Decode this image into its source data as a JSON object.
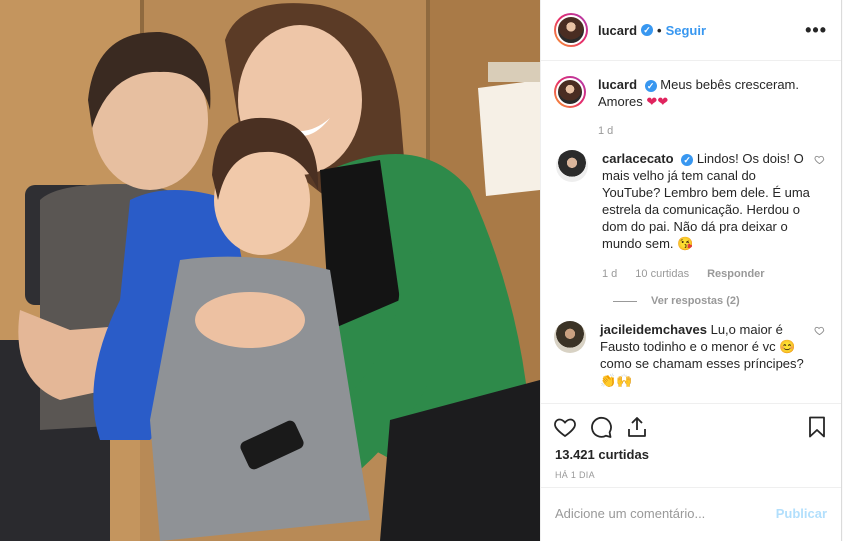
{
  "post": {
    "author": "lucard",
    "follow_label": "Seguir",
    "more_label": "•••",
    "caption_text": "Meus bebês cresceram. Amores",
    "caption_time": "1 d",
    "likes_text": "13.421 curtidas",
    "time_ago": "HÁ 1 DIA"
  },
  "comments": [
    {
      "user": "carlacecato",
      "text": "Lindos! Os dois! O mais velho já tem canal do YouTube? Lembro bem dele. É uma estrela da comunicação. Herdou o dom do pai. Não dá pra deixar o mundo sem.",
      "time": "1 d",
      "likes": "10 curtidas",
      "reply_label": "Responder",
      "view_replies": "Ver respostas (2)"
    },
    {
      "user": "jacileidemchaves",
      "text": "Lu,o maior é Fausto todinho e o menor é vc",
      "text2": "como se chamam esses príncipes?"
    }
  ],
  "add_comment": {
    "placeholder": "Adicione um comentário...",
    "post_label": "Publicar"
  },
  "colors": {
    "accent": "#3897f0",
    "publish_disabled": "#b2dffc",
    "muted": "#999999"
  },
  "icons": [
    "heart-icon",
    "comment-icon",
    "share-icon",
    "bookmark-icon",
    "verified-icon",
    "more-icon"
  ]
}
